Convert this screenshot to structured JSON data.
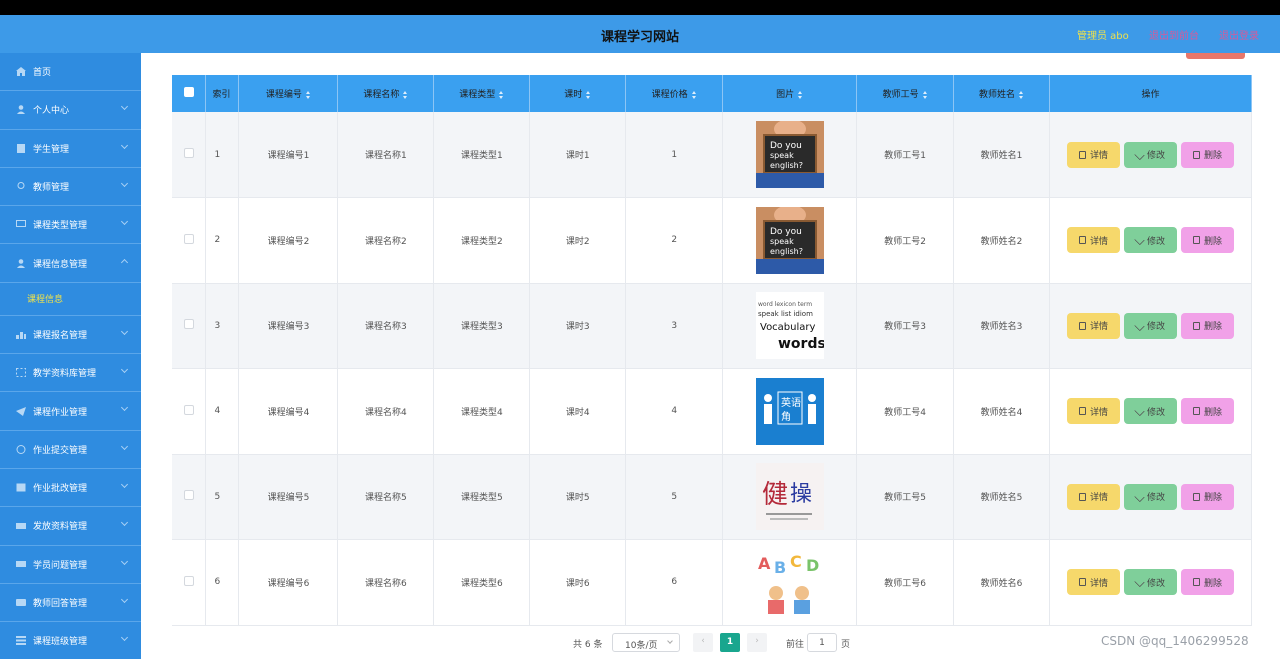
{
  "header": {
    "title": "课程学习网站",
    "admin": "管理员 abo",
    "back_link": "退出到前台",
    "logout_link": "退出登录"
  },
  "sidebar": {
    "items": [
      {
        "label": "首页",
        "icon": "home-icon"
      },
      {
        "label": "个人中心",
        "icon": "user-icon"
      },
      {
        "label": "学生管理",
        "icon": "doc-icon"
      },
      {
        "label": "教师管理",
        "icon": "location-icon"
      },
      {
        "label": "课程类型管理",
        "icon": "chat-icon"
      },
      {
        "label": "课程信息管理",
        "icon": "user-icon"
      },
      {
        "label": "课程报名管理",
        "icon": "chart-icon"
      },
      {
        "label": "教学资料库管理",
        "icon": "frame-icon"
      },
      {
        "label": "课程作业管理",
        "icon": "send-icon"
      },
      {
        "label": "作业提交管理",
        "icon": "clock-icon"
      },
      {
        "label": "作业批改管理",
        "icon": "check-icon"
      },
      {
        "label": "发放资料管理",
        "icon": "folder-icon"
      },
      {
        "label": "学员问题管理",
        "icon": "message-icon"
      },
      {
        "label": "教师回答管理",
        "icon": "card-icon"
      },
      {
        "label": "课程班级管理",
        "icon": "list-icon"
      }
    ],
    "active_sub": "课程信息"
  },
  "table": {
    "columns": [
      "索引",
      "课程编号",
      "课程名称",
      "课程类型",
      "课时",
      "课程价格",
      "图片",
      "教师工号",
      "教师姓名",
      "操作"
    ],
    "rows": [
      {
        "idx": "1",
        "code": "课程编号1",
        "name": "课程名称1",
        "type": "课程类型1",
        "hours": "课时1",
        "price": "1",
        "pic": "do-you-speak-english-image",
        "tno": "教师工号1",
        "tname": "教师姓名1"
      },
      {
        "idx": "2",
        "code": "课程编号2",
        "name": "课程名称2",
        "type": "课程类型2",
        "hours": "课时2",
        "price": "2",
        "pic": "do-you-speak-english-image",
        "tno": "教师工号2",
        "tname": "教师姓名2"
      },
      {
        "idx": "3",
        "code": "课程编号3",
        "name": "课程名称3",
        "type": "课程类型3",
        "hours": "课时3",
        "price": "3",
        "pic": "vocabulary-words-image",
        "tno": "教师工号3",
        "tname": "教师姓名3"
      },
      {
        "idx": "4",
        "code": "课程编号4",
        "name": "课程名称4",
        "type": "课程类型4",
        "hours": "课时4",
        "price": "4",
        "pic": "english-corner-image",
        "tno": "教师工号4",
        "tname": "教师姓名4"
      },
      {
        "idx": "5",
        "code": "课程编号5",
        "name": "课程名称5",
        "type": "课程类型5",
        "hours": "课时5",
        "price": "5",
        "pic": "calligraphy-image",
        "tno": "教师工号5",
        "tname": "教师姓名5"
      },
      {
        "idx": "6",
        "code": "课程编号6",
        "name": "课程名称6",
        "type": "课程类型6",
        "hours": "课时6",
        "price": "6",
        "pic": "abcd-kids-image",
        "tno": "教师工号6",
        "tname": "教师姓名6"
      }
    ],
    "actions": {
      "detail": "详情",
      "edit": "修改",
      "delete": "删除"
    }
  },
  "pager": {
    "total": "共 6 条",
    "page_size": "10条/页",
    "current": "1",
    "goto": "前往",
    "goto_value": "1",
    "page_unit": "页"
  },
  "watermark": "CSDN @qq_1406299528",
  "colors": {
    "header": "#3d9ae8",
    "sidebar": "#2f8ce0",
    "table_head": "#3aa0f0",
    "detail": "#f6d86b",
    "edit": "#7fcf9a",
    "delete": "#f1a1e8",
    "active_page": "#19a68e"
  }
}
